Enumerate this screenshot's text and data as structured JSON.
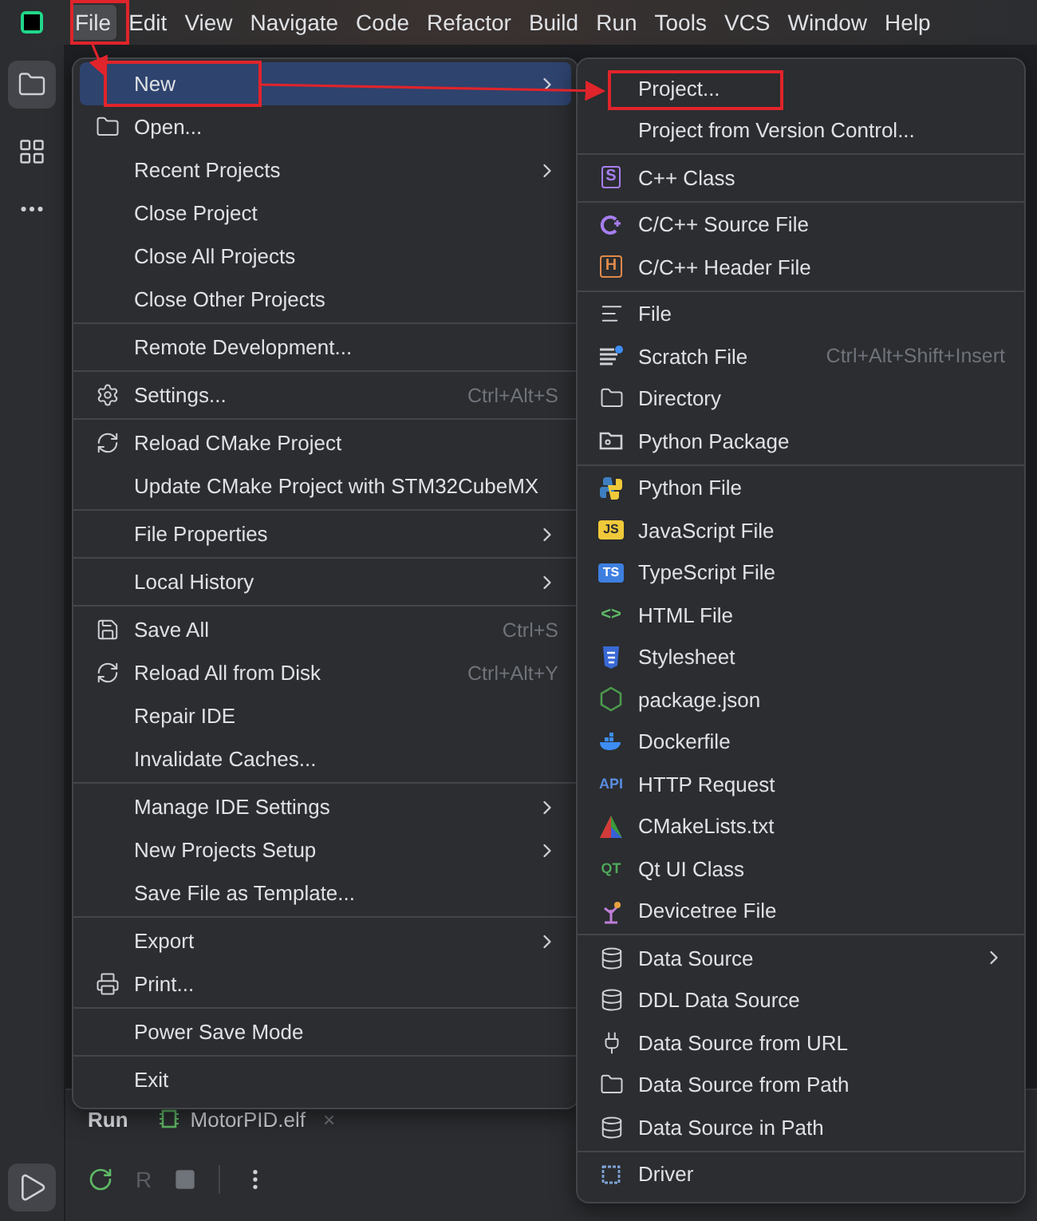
{
  "menu_bar": [
    {
      "label": "File",
      "selected": true
    },
    {
      "label": "Edit",
      "selected": false
    },
    {
      "label": "View",
      "selected": false
    },
    {
      "label": "Navigate",
      "selected": false
    },
    {
      "label": "Code",
      "selected": false
    },
    {
      "label": "Refactor",
      "selected": false
    },
    {
      "label": "Build",
      "selected": false
    },
    {
      "label": "Run",
      "selected": false
    },
    {
      "label": "Tools",
      "selected": false
    },
    {
      "label": "VCS",
      "selected": false
    },
    {
      "label": "Window",
      "selected": false
    },
    {
      "label": "Help",
      "selected": false
    }
  ],
  "left_toolbar": [
    {
      "selected": true
    },
    {
      "selected": false
    }
  ],
  "file_menu": {
    "groups": [
      [
        {
          "label": "New",
          "submenu": true,
          "selected": true
        },
        {
          "label": "Open...",
          "submenu": false,
          "selected": false
        },
        {
          "label": "Recent Projects",
          "submenu": true,
          "selected": false
        },
        {
          "label": "Close Project",
          "submenu": false,
          "selected": false
        },
        {
          "label": "Close All Projects",
          "submenu": false,
          "selected": false
        },
        {
          "label": "Close Other Projects",
          "submenu": false,
          "selected": false
        }
      ],
      [
        {
          "label": "Remote Development...",
          "submenu": false,
          "selected": false
        }
      ],
      [
        {
          "label": "Settings...",
          "shortcut": "Ctrl+Alt+S",
          "submenu": false,
          "selected": false
        }
      ],
      [
        {
          "label": "Reload CMake Project",
          "submenu": false,
          "selected": false
        },
        {
          "label": "Update CMake Project with STM32CubeMX",
          "submenu": false,
          "selected": false
        }
      ],
      [
        {
          "label": "File Properties",
          "submenu": true,
          "selected": false
        }
      ],
      [
        {
          "label": "Local History",
          "submenu": true,
          "selected": false
        }
      ],
      [
        {
          "label": "Save All",
          "shortcut": "Ctrl+S",
          "submenu": false,
          "selected": false
        },
        {
          "label": "Reload All from Disk",
          "shortcut": "Ctrl+Alt+Y",
          "submenu": false,
          "selected": false
        },
        {
          "label": "Repair IDE",
          "submenu": false,
          "selected": false
        },
        {
          "label": "Invalidate Caches...",
          "submenu": false,
          "selected": false
        }
      ],
      [
        {
          "label": "Manage IDE Settings",
          "submenu": true,
          "selected": false
        },
        {
          "label": "New Projects Setup",
          "submenu": true,
          "selected": false
        },
        {
          "label": "Save File as Template...",
          "submenu": false,
          "selected": false
        }
      ],
      [
        {
          "label": "Export",
          "submenu": true,
          "selected": false
        },
        {
          "label": "Print...",
          "submenu": false,
          "selected": false
        }
      ],
      [
        {
          "label": "Power Save Mode",
          "submenu": false,
          "selected": false
        }
      ],
      [
        {
          "label": "Exit",
          "submenu": false,
          "selected": false
        }
      ]
    ]
  },
  "new_submenu": {
    "groups": [
      [
        {
          "label": "Project...",
          "submenu": false,
          "selected": false
        },
        {
          "label": "Project from Version Control...",
          "submenu": false,
          "selected": false
        }
      ],
      [
        {
          "label": "C++ Class",
          "badge": "S",
          "submenu": false,
          "selected": false
        }
      ],
      [
        {
          "label": "C/C++ Source File",
          "submenu": false,
          "selected": false
        },
        {
          "label": "C/C++ Header File",
          "badge": "H",
          "submenu": false,
          "selected": false
        }
      ],
      [
        {
          "label": "File",
          "submenu": false,
          "selected": false
        },
        {
          "label": "Scratch File",
          "shortcut": "Ctrl+Alt+Shift+Insert",
          "submenu": false,
          "selected": false
        },
        {
          "label": "Directory",
          "submenu": false,
          "selected": false
        },
        {
          "label": "Python Package",
          "submenu": false,
          "selected": false
        }
      ],
      [
        {
          "label": "Python File",
          "submenu": false,
          "selected": false
        },
        {
          "label": "JavaScript File",
          "badge": "JS",
          "submenu": false,
          "selected": false
        },
        {
          "label": "TypeScript File",
          "badge": "TS",
          "submenu": false,
          "selected": false
        },
        {
          "label": "HTML File",
          "badge": "<>",
          "submenu": false,
          "selected": false
        },
        {
          "label": "Stylesheet",
          "submenu": false,
          "selected": false
        },
        {
          "label": "package.json",
          "submenu": false,
          "selected": false
        },
        {
          "label": "Dockerfile",
          "submenu": false,
          "selected": false
        },
        {
          "label": "HTTP Request",
          "badge": "API",
          "submenu": false,
          "selected": false
        },
        {
          "label": "CMakeLists.txt",
          "submenu": false,
          "selected": false
        },
        {
          "label": "Qt UI Class",
          "badge": "QT",
          "submenu": false,
          "selected": false
        },
        {
          "label": "Devicetree File",
          "submenu": false,
          "selected": false
        }
      ],
      [
        {
          "label": "Data Source",
          "submenu": true,
          "selected": false
        },
        {
          "label": "DDL Data Source",
          "submenu": false,
          "selected": false
        },
        {
          "label": "Data Source from URL",
          "submenu": false,
          "selected": false
        },
        {
          "label": "Data Source from Path",
          "submenu": false,
          "selected": false
        },
        {
          "label": "Data Source in Path",
          "submenu": false,
          "selected": false
        }
      ],
      [
        {
          "label": "Driver",
          "submenu": false,
          "selected": false
        }
      ]
    ]
  },
  "run_panel": {
    "title": "Run",
    "tab": {
      "label": "MotorPID.elf",
      "close": "×"
    },
    "toolbar_glyph": "R"
  }
}
